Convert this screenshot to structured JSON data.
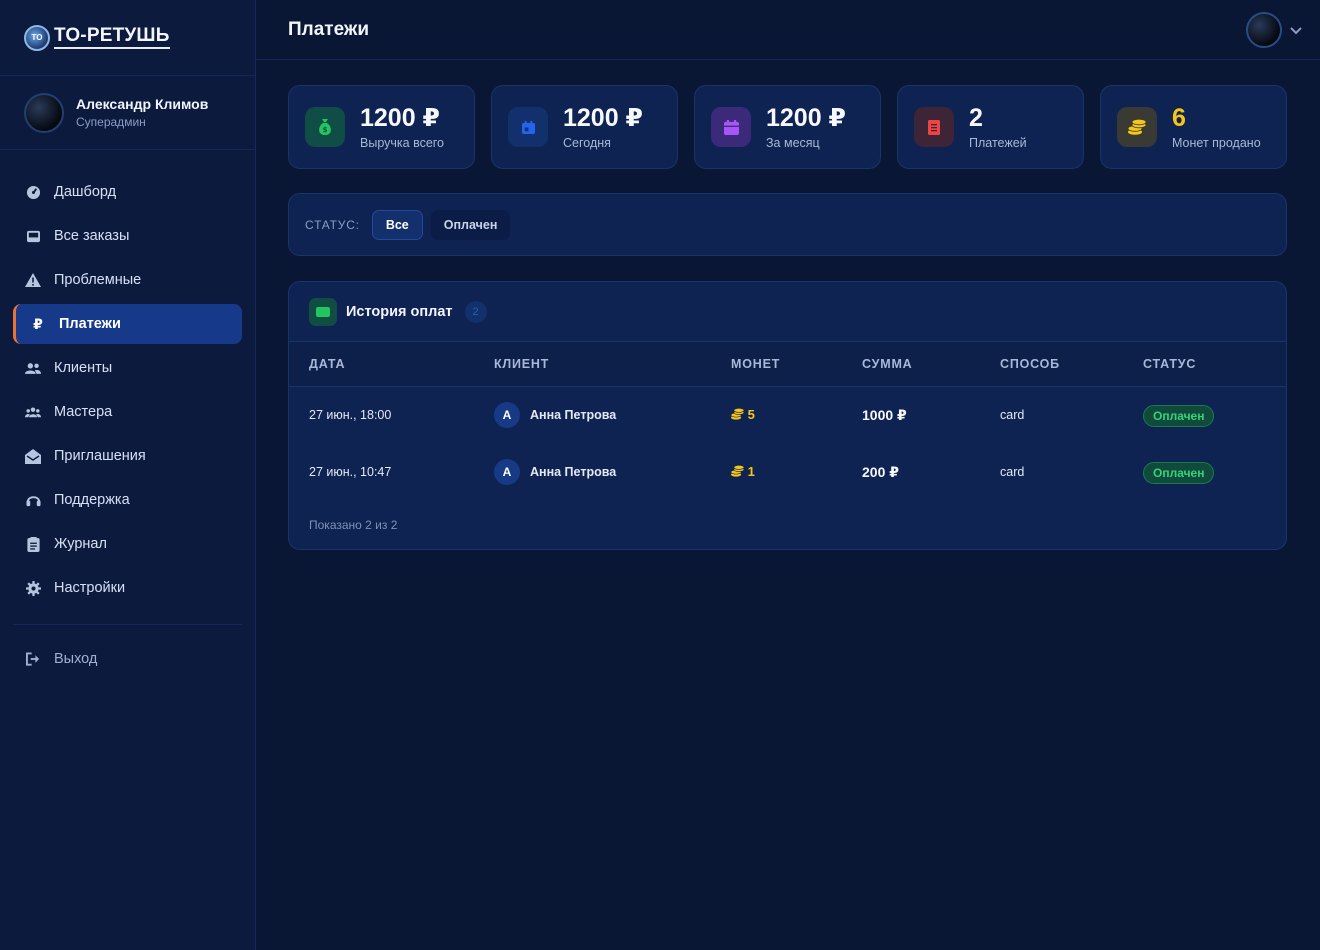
{
  "brand": {
    "name": "ТО-РЕТУШЬ",
    "badge": "TO"
  },
  "user": {
    "name": "Александр Климов",
    "role": "Суперадмин"
  },
  "nav": [
    {
      "label": "Дашборд",
      "icon": "dashboard-icon"
    },
    {
      "label": "Все заказы",
      "icon": "inbox-icon"
    },
    {
      "label": "Проблемные",
      "icon": "warning-icon"
    },
    {
      "label": "Платежи",
      "icon": "ruble-icon",
      "active": true
    },
    {
      "label": "Клиенты",
      "icon": "users-icon"
    },
    {
      "label": "Мастера",
      "icon": "team-icon"
    },
    {
      "label": "Приглашения",
      "icon": "invite-icon"
    },
    {
      "label": "Поддержка",
      "icon": "support-icon"
    },
    {
      "label": "Журнал",
      "icon": "journal-icon"
    },
    {
      "label": "Настройки",
      "icon": "settings-icon"
    }
  ],
  "logout": {
    "label": "Выход",
    "icon": "logout-icon"
  },
  "header": {
    "title": "Платежи"
  },
  "stats": [
    {
      "value": "1200 ₽",
      "label": "Выручка всего",
      "icon": "money-bag-icon",
      "color": "#22c55e",
      "bg": "#0f4d46"
    },
    {
      "value": "1200 ₽",
      "label": "Сегодня",
      "icon": "calendar-day-icon",
      "color": "#2563eb",
      "bg": "#12306b"
    },
    {
      "value": "1200 ₽",
      "label": "За месяц",
      "icon": "calendar-icon",
      "color": "#a855f7",
      "bg": "#3b2a7a"
    },
    {
      "value": "2",
      "label": "Платежей",
      "icon": "receipt-icon",
      "color": "#ef4444",
      "bg": "#3d2436"
    },
    {
      "value": "6",
      "label": "Монет продано",
      "icon": "coins-icon",
      "color": "#f5c518",
      "bg": "#3a3a34",
      "value_color": "#f5c518"
    }
  ],
  "filter": {
    "label": "СТАТУС:",
    "options": [
      "Все",
      "Оплачен"
    ],
    "selected": "Все"
  },
  "table": {
    "title": "История оплат",
    "count": "2",
    "columns": [
      "ДАТА",
      "КЛИЕНТ",
      "МОНЕТ",
      "СУММА",
      "СПОСОБ",
      "СТАТУС"
    ],
    "rows": [
      {
        "date": "27 июн., 18:00",
        "initial": "А",
        "client": "Анна Петрова",
        "coins": "5",
        "amount": "1000 ₽",
        "method": "card",
        "status": "Оплачен"
      },
      {
        "date": "27 июн., 10:47",
        "initial": "А",
        "client": "Анна Петрова",
        "coins": "1",
        "amount": "200 ₽",
        "method": "card",
        "status": "Оплачен"
      }
    ],
    "footer": "Показано 2 из 2"
  }
}
